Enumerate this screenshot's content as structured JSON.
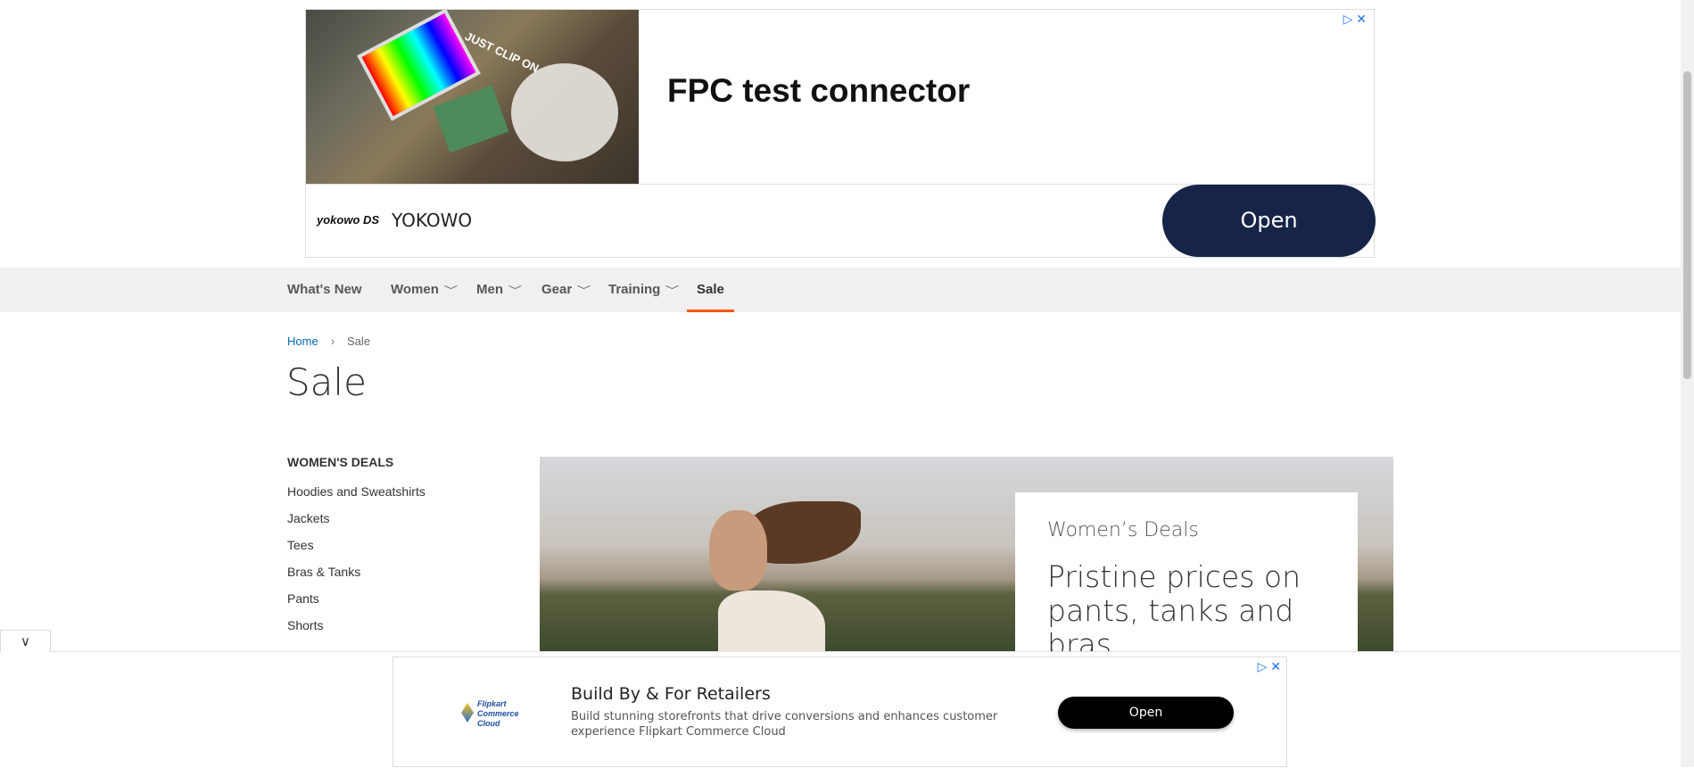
{
  "top_ad": {
    "image_caption": "JUST CLIP ON",
    "headline": "FPC test connector",
    "brand_logo": "yokowo DS",
    "brand_name": "YOKOWO",
    "button": "Open",
    "adchoices": "▷ ✕"
  },
  "nav": {
    "items": [
      {
        "label": "What's New",
        "dropdown": false
      },
      {
        "label": "Women",
        "dropdown": true
      },
      {
        "label": "Men",
        "dropdown": true
      },
      {
        "label": "Gear",
        "dropdown": true
      },
      {
        "label": "Training",
        "dropdown": true
      },
      {
        "label": "Sale",
        "dropdown": false,
        "active": true
      }
    ],
    "chevron": "﹀",
    "active_color": "#ff5501"
  },
  "breadcrumb": {
    "home": "Home",
    "separator": "›",
    "current": "Sale"
  },
  "page_title": "Sale",
  "sidebar": {
    "heading": "WOMEN'S DEALS",
    "links": [
      "Hoodies and Sweatshirts",
      "Jackets",
      "Tees",
      "Bras & Tanks",
      "Pants",
      "Shorts"
    ]
  },
  "banner": {
    "label": "Women’s Deals",
    "title": "Pristine prices on pants, tanks and bras"
  },
  "collapse_tab": "∨",
  "bottom_ad": {
    "logo_text": "Flipkart Commerce Cloud",
    "title": "Build By & For Retailers",
    "description": "Build stunning storefronts that drive conversions and enhances customer experience Flipkart Commerce Cloud",
    "button": "Open",
    "adchoices": "▷ ✕"
  }
}
